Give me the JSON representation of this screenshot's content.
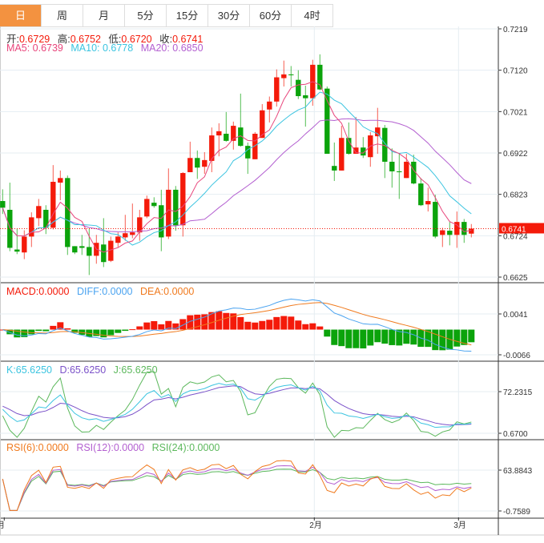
{
  "tabs": [
    {
      "label": "日",
      "active": true
    },
    {
      "label": "周"
    },
    {
      "label": "月"
    },
    {
      "label": "5分"
    },
    {
      "label": "15分"
    },
    {
      "label": "30分"
    },
    {
      "label": "60分"
    },
    {
      "label": "4时"
    }
  ],
  "ohlc_legend": {
    "open_label": "开:",
    "open": "0.6729",
    "high_label": "高:",
    "high": "0.6752",
    "low_label": "低:",
    "low": "0.6720",
    "close_label": "收:",
    "close": "0.6741"
  },
  "ma_legend": {
    "ma5": "MA5: 0.6739",
    "ma10": "MA10: 0.6778",
    "ma20": "MA20: 0.6850"
  },
  "macd_legend": {
    "macd": "MACD:0.0000",
    "diff": "DIFF:0.0000",
    "dea": "DEA:0.0000"
  },
  "kdj_legend": {
    "k": "K:65.6250",
    "d": "D:65.6250",
    "j": "J:65.6250"
  },
  "rsi_legend": {
    "rsi6": "RSI(6):0.0000",
    "rsi12": "RSI(12):0.0000",
    "rsi24": "RSI(24):0.0000"
  },
  "colors": {
    "up": "#f41a0a",
    "down": "#0ba30b",
    "active_tab": "#f39240",
    "ma5": "#e8467c",
    "ma10": "#3bc4e0",
    "ma20": "#b35fd0",
    "diff": "#4aa3f0",
    "dea": "#f07a1e",
    "k": "#3bc4e0",
    "d": "#7b52c9",
    "j": "#5cb85c",
    "rsi6": "#f07a1e",
    "rsi12": "#b35fd0",
    "rsi24": "#5cb85c"
  },
  "chart_data": {
    "type": "candlestick",
    "price_ticks": [
      "0.7219",
      "0.7120",
      "0.7021",
      "0.6922",
      "0.6823",
      "0.6724",
      "0.6625"
    ],
    "price_range": [
      0.6625,
      0.7219
    ],
    "last_price": "0.6741",
    "macd_ticks": [
      "0.0041",
      "-0.0066"
    ],
    "kdj_ticks": [
      "72.2315",
      "0.6700"
    ],
    "rsi_ticks": [
      "63.8843",
      "-0.7589"
    ],
    "x_labels": [
      {
        "label": "月",
        "index": 0
      },
      {
        "label": "2月",
        "index": 43
      },
      {
        "label": "3月",
        "index": 63
      }
    ],
    "candles": [
      [
        0.6807,
        0.6835,
        0.6776,
        0.6791
      ],
      [
        0.6786,
        0.6851,
        0.6687,
        0.6695
      ],
      [
        0.6691,
        0.6741,
        0.668,
        0.6686
      ],
      [
        0.6684,
        0.6737,
        0.6668,
        0.6722
      ],
      [
        0.6722,
        0.678,
        0.6697,
        0.6768
      ],
      [
        0.6766,
        0.6812,
        0.6747,
        0.6795
      ],
      [
        0.6786,
        0.6797,
        0.6728,
        0.6743
      ],
      [
        0.6743,
        0.6893,
        0.6739,
        0.6853
      ],
      [
        0.6851,
        0.688,
        0.6809,
        0.6862
      ],
      [
        0.6862,
        0.6868,
        0.6678,
        0.6697
      ],
      [
        0.6699,
        0.6699,
        0.668,
        0.6684
      ],
      [
        0.6699,
        0.6726,
        0.6678,
        0.6695
      ],
      [
        0.6697,
        0.6741,
        0.663,
        0.6676
      ],
      [
        0.6676,
        0.6726,
        0.6657,
        0.6707
      ],
      [
        0.6703,
        0.6766,
        0.6649,
        0.6661
      ],
      [
        0.6664,
        0.6722,
        0.6661,
        0.6712
      ],
      [
        0.6707,
        0.6732,
        0.6697,
        0.6722
      ],
      [
        0.672,
        0.6774,
        0.6712,
        0.673
      ],
      [
        0.6726,
        0.6801,
        0.6718,
        0.6732
      ],
      [
        0.6732,
        0.6786,
        0.6712,
        0.6768
      ],
      [
        0.677,
        0.682,
        0.6766,
        0.6812
      ],
      [
        0.6803,
        0.6816,
        0.6791,
        0.6795
      ],
      [
        0.6797,
        0.6834,
        0.6687,
        0.672
      ],
      [
        0.6722,
        0.6885,
        0.6716,
        0.6834
      ],
      [
        0.6834,
        0.6843,
        0.6736,
        0.6749
      ],
      [
        0.6749,
        0.6876,
        0.6722,
        0.6874
      ],
      [
        0.6876,
        0.6949,
        0.6876,
        0.691
      ],
      [
        0.691,
        0.6928,
        0.686,
        0.6887
      ],
      [
        0.6889,
        0.6924,
        0.6872,
        0.6905
      ],
      [
        0.6903,
        0.6983,
        0.6876,
        0.6964
      ],
      [
        0.6964,
        0.6993,
        0.6914,
        0.6974
      ],
      [
        0.6968,
        0.702,
        0.6949,
        0.6951
      ],
      [
        0.6951,
        0.6997,
        0.693,
        0.6987
      ],
      [
        0.6983,
        0.7064,
        0.6937,
        0.6939
      ],
      [
        0.6939,
        0.6947,
        0.6872,
        0.6909
      ],
      [
        0.6907,
        0.6972,
        0.6907,
        0.6968
      ],
      [
        0.6958,
        0.7039,
        0.6958,
        0.7024
      ],
      [
        0.7026,
        0.7057,
        0.6995,
        0.7045
      ],
      [
        0.7045,
        0.7122,
        0.7033,
        0.7103
      ],
      [
        0.7101,
        0.7143,
        0.7081,
        0.711
      ],
      [
        0.711,
        0.713,
        0.7081,
        0.7108
      ],
      [
        0.7097,
        0.712,
        0.7051,
        0.7058
      ],
      [
        0.706,
        0.7083,
        0.6985,
        0.7053
      ],
      [
        0.7053,
        0.7145,
        0.7035,
        0.7133
      ],
      [
        0.7133,
        0.7158,
        0.7072,
        0.7074
      ],
      [
        0.7076,
        0.7081,
        0.692,
        0.692
      ],
      [
        0.6891,
        0.6947,
        0.6855,
        0.688
      ],
      [
        0.688,
        0.6987,
        0.688,
        0.6958
      ],
      [
        0.6958,
        0.6995,
        0.6918,
        0.692
      ],
      [
        0.692,
        0.7008,
        0.692,
        0.6935
      ],
      [
        0.6935,
        0.696,
        0.691,
        0.6916
      ],
      [
        0.6912,
        0.6972,
        0.6889,
        0.6964
      ],
      [
        0.6962,
        0.703,
        0.692,
        0.6983
      ],
      [
        0.6982,
        0.6989,
        0.6862,
        0.6901
      ],
      [
        0.6901,
        0.6933,
        0.6839,
        0.6878
      ],
      [
        0.6878,
        0.692,
        0.6812,
        0.6876
      ],
      [
        0.6862,
        0.692,
        0.6862,
        0.6901
      ],
      [
        0.6901,
        0.6918,
        0.6847,
        0.6849
      ],
      [
        0.6849,
        0.6862,
        0.6795,
        0.6797
      ],
      [
        0.6799,
        0.6839,
        0.6782,
        0.6807
      ],
      [
        0.6805,
        0.6822,
        0.6718,
        0.6722
      ],
      [
        0.6726,
        0.6743,
        0.6697,
        0.6737
      ],
      [
        0.6736,
        0.6757,
        0.6701,
        0.6726
      ],
      [
        0.6726,
        0.6782,
        0.6695,
        0.6757
      ],
      [
        0.6757,
        0.6764,
        0.6707,
        0.6726
      ],
      [
        0.6729,
        0.6752,
        0.672,
        0.6741
      ]
    ]
  }
}
